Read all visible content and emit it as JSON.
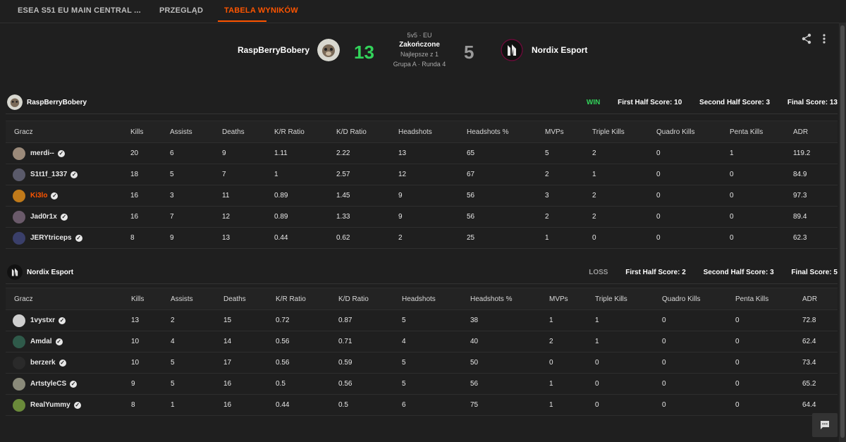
{
  "tabs": [
    "ESEA S51 EU MAIN CENTRAL ...",
    "PRZEGLĄD",
    "TABELA WYNIKÓW"
  ],
  "match": {
    "team1": "RaspBerryBobery",
    "team2": "Nordix Esport",
    "score1": "13",
    "score2": "5",
    "format": "5v5 · EU",
    "status": "Zakończone",
    "best_of": "Najlepsze z 1",
    "group": "Grupa A · Runda 4"
  },
  "columns": [
    "Gracz",
    "Kills",
    "Assists",
    "Deaths",
    "K/R Ratio",
    "K/D Ratio",
    "Headshots",
    "Headshots %",
    "MVPs",
    "Triple Kills",
    "Quadro Kills",
    "Penta Kills",
    "ADR"
  ],
  "teams": [
    {
      "name": "RaspBerryBobery",
      "result": "WIN",
      "first_half": "First Half Score: 10",
      "second_half": "Second Half Score: 3",
      "final": "Final Score: 13",
      "players": [
        [
          "merdi--",
          "20",
          "6",
          "9",
          "1.11",
          "2.22",
          "13",
          "65",
          "5",
          "2",
          "0",
          "1",
          "119.2"
        ],
        [
          "S1t1f_1337",
          "18",
          "5",
          "7",
          "1",
          "2.57",
          "12",
          "67",
          "2",
          "1",
          "0",
          "0",
          "84.9"
        ],
        [
          "Ki3lo",
          "16",
          "3",
          "11",
          "0.89",
          "1.45",
          "9",
          "56",
          "3",
          "2",
          "0",
          "0",
          "97.3"
        ],
        [
          "Jad0r1x",
          "16",
          "7",
          "12",
          "0.89",
          "1.33",
          "9",
          "56",
          "2",
          "2",
          "0",
          "0",
          "89.4"
        ],
        [
          "JERYtriceps",
          "8",
          "9",
          "13",
          "0.44",
          "0.62",
          "2",
          "25",
          "1",
          "0",
          "0",
          "0",
          "62.3"
        ]
      ]
    },
    {
      "name": "Nordix Esport",
      "result": "LOSS",
      "first_half": "First Half Score: 2",
      "second_half": "Second Half Score: 3",
      "final": "Final Score: 5",
      "players": [
        [
          "1vystxr",
          "13",
          "2",
          "15",
          "0.72",
          "0.87",
          "5",
          "38",
          "1",
          "1",
          "0",
          "0",
          "72.8"
        ],
        [
          "Amdal",
          "10",
          "4",
          "14",
          "0.56",
          "0.71",
          "4",
          "40",
          "2",
          "1",
          "0",
          "0",
          "62.4"
        ],
        [
          "berzerk",
          "10",
          "5",
          "17",
          "0.56",
          "0.59",
          "5",
          "50",
          "0",
          "0",
          "0",
          "0",
          "73.4"
        ],
        [
          "ArtstyleCS",
          "9",
          "5",
          "16",
          "0.5",
          "0.56",
          "5",
          "56",
          "1",
          "0",
          "0",
          "0",
          "65.2"
        ],
        [
          "RealYummy",
          "8",
          "1",
          "16",
          "0.44",
          "0.5",
          "6",
          "75",
          "1",
          "0",
          "0",
          "0",
          "64.4"
        ]
      ]
    }
  ],
  "icons": {
    "share": "share-icon",
    "more": "more-vertical-icon",
    "chat": "chat-icon",
    "verified": "verified-icon"
  },
  "colors": {
    "accent": "#ff5500",
    "win": "#32d35a",
    "score_win": "#32d35a",
    "score_loss": "#9a9a9a"
  }
}
